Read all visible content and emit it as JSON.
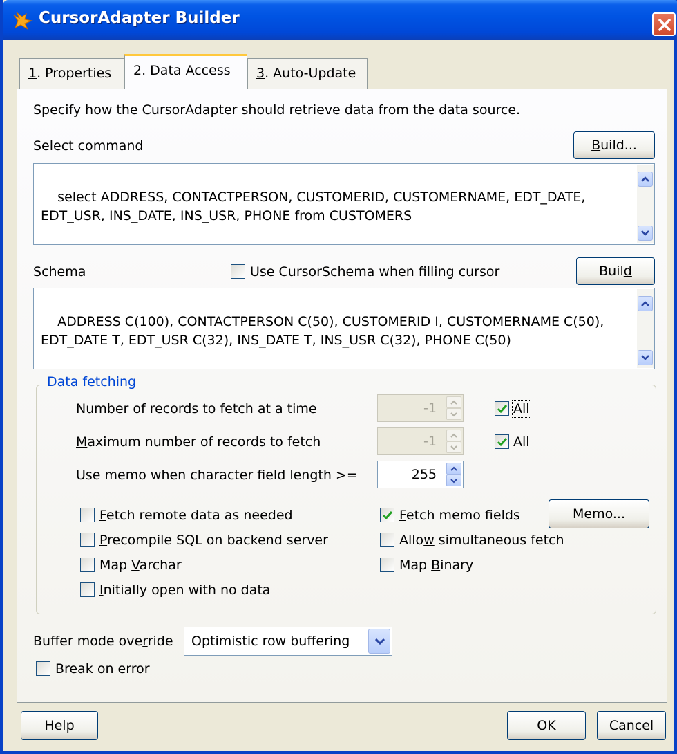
{
  "window": {
    "title": "CursorAdapter Builder"
  },
  "tabs": [
    {
      "key": "1",
      "label": ". Properties"
    },
    {
      "key": "",
      "label": "2. Data Access"
    },
    {
      "key": "3",
      "label": ". Auto-Update"
    }
  ],
  "data_access": {
    "intro": "Specify how the CursorAdapter should retrieve data from the data source.",
    "select_command": {
      "label_pre": "Select ",
      "label_key": "c",
      "label_post": "ommand",
      "build_key": "B",
      "build_rest": "uild...",
      "text": "select ADDRESS, CONTACTPERSON, CUSTOMERID, CUSTOMERNAME, EDT_DATE, EDT_USR, INS_DATE, INS_USR, PHONE from CUSTOMERS"
    },
    "schema": {
      "label_key": "S",
      "label_rest": "chema",
      "use_cursorschema_pre": "Use CursorSc",
      "use_cursorschema_key": "h",
      "use_cursorschema_post": "ema when filling cursor",
      "use_cursorschema_checked": false,
      "build_pre": "Buil",
      "build_key": "d",
      "text": "ADDRESS C(100), CONTACTPERSON C(50), CUSTOMERID I, CUSTOMERNAME C(50), EDT_DATE T, EDT_USR C(32), INS_DATE T, INS_USR C(32), PHONE C(50)"
    },
    "data_fetching": {
      "title": "Data fetching",
      "fetch_size": {
        "label_key": "N",
        "label_rest": "umber of records to fetch at a time",
        "value": "-1",
        "all_label": "All",
        "all_checked": true
      },
      "max_records": {
        "label_key": "M",
        "label_rest": "aximum number of records to fetch",
        "value": "-1",
        "all_label": "All",
        "all_checked": true
      },
      "memo_length": {
        "label": "Use memo when character field length >=",
        "value": "255"
      },
      "options_left": [
        {
          "key": "F",
          "rest": "etch remote data as needed",
          "checked": false
        },
        {
          "key": "P",
          "rest": "recompile SQL on backend server",
          "checked": false
        },
        {
          "pre": "Map ",
          "key": "V",
          "rest": "archar",
          "checked": false
        },
        {
          "key": "I",
          "rest": "nitially open with no data",
          "checked": false
        }
      ],
      "options_right": [
        {
          "key": "F",
          "rest": "etch memo fields",
          "checked": true
        },
        {
          "pre": "Allo",
          "key": "w",
          "rest": " simultaneous fetch",
          "checked": false
        },
        {
          "pre": "Map ",
          "key": "B",
          "rest": "inary",
          "checked": false
        }
      ],
      "memo_button": {
        "pre": "Mem",
        "key": "o",
        "rest": "..."
      }
    },
    "buffer_mode": {
      "label_pre": "Buffer mode ove",
      "label_key": "r",
      "label_post": "ride",
      "value": "Optimistic row buffering"
    },
    "break_on_error": {
      "pre": "Brea",
      "key": "k",
      "rest": " on error",
      "checked": false
    }
  },
  "footer": {
    "help": "Help",
    "ok": "OK",
    "cancel": "Cancel"
  },
  "colors": {
    "titlebar": "#0054e3",
    "group_title": "#0046d5",
    "tab_highlight": "#ffc83c"
  }
}
